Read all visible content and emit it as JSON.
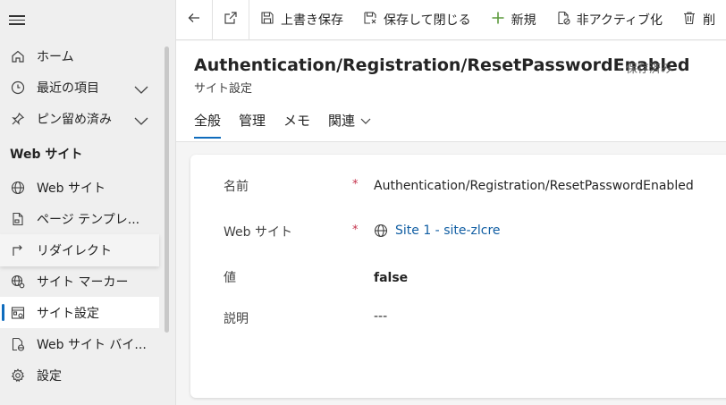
{
  "commandbar": {
    "back_icon": "arrow-left-icon",
    "popout_icon": "open-in-new-window-icon",
    "save_label": "上書き保存",
    "save_close_label": "保存して閉じる",
    "new_label": "新規",
    "deactivate_label": "非アクティブ化",
    "delete_label": "削"
  },
  "sidebar": {
    "home": "ホーム",
    "recent": "最近の項目",
    "pinned": "ピン留め済み",
    "section": "Web サイト",
    "items": [
      {
        "label": "Web サイト",
        "icon": "globe-icon"
      },
      {
        "label": "ページ テンプレ...",
        "icon": "page-template-icon"
      },
      {
        "label": "リダイレクト",
        "icon": "redirect-arrow-icon"
      },
      {
        "label": "サイト マーカー",
        "icon": "globe-settings-icon"
      },
      {
        "label": "サイト設定",
        "icon": "settings-form-icon"
      },
      {
        "label": "Web サイト バイ...",
        "icon": "globe-document-icon"
      },
      {
        "label": "設定",
        "icon": "gear-icon"
      }
    ]
  },
  "record": {
    "title": "Authentication/Registration/ResetPasswordEnabled",
    "status": "- 保存済み",
    "subtitle": "サイト設定"
  },
  "tabs": [
    "全般",
    "管理",
    "メモ",
    "関連"
  ],
  "form": {
    "name_label": "名前",
    "name_value": "Authentication/Registration/ResetPasswordEnabled",
    "website_label": "Web サイト",
    "website_value": "Site 1 - site-zlcre",
    "value_label": "値",
    "value_value": "false",
    "desc_label": "説明",
    "desc_value": "---",
    "required_mark": "*"
  },
  "colors": {
    "accent": "#0f6cbd",
    "link": "#115ea3",
    "required": "#c4314b"
  }
}
